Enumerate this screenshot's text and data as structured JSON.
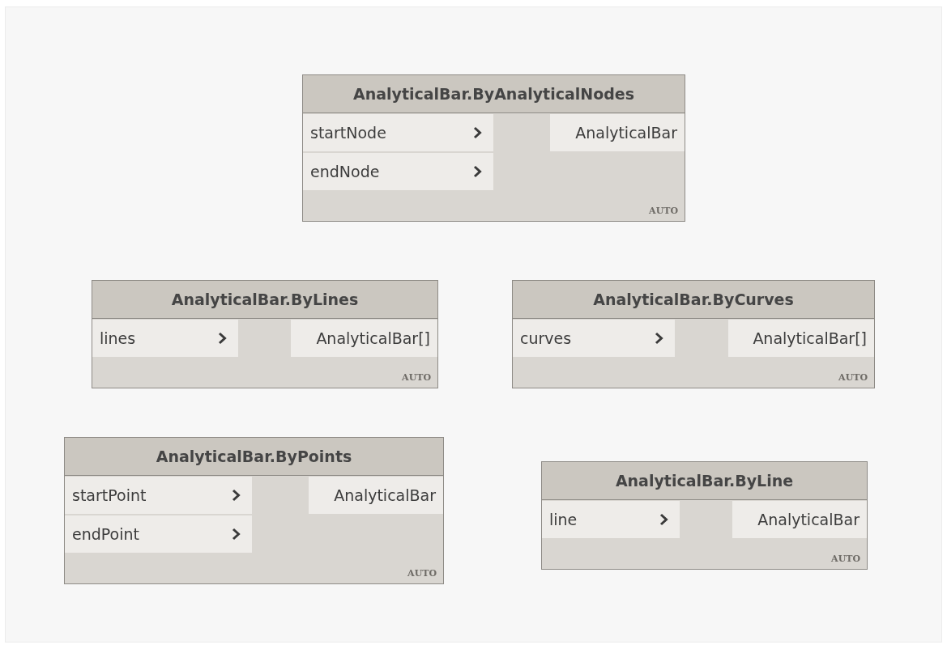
{
  "nodes": [
    {
      "title": "AnalyticalBar.ByAnalyticalNodes",
      "inputs": [
        "startNode",
        "endNode"
      ],
      "outputs": [
        "AnalyticalBar"
      ],
      "lacing": "AUTO"
    },
    {
      "title": "AnalyticalBar.ByLines",
      "inputs": [
        "lines"
      ],
      "outputs": [
        "AnalyticalBar[]"
      ],
      "lacing": "AUTO"
    },
    {
      "title": "AnalyticalBar.ByCurves",
      "inputs": [
        "curves"
      ],
      "outputs": [
        "AnalyticalBar[]"
      ],
      "lacing": "AUTO"
    },
    {
      "title": "AnalyticalBar.ByPoints",
      "inputs": [
        "startPoint",
        "endPoint"
      ],
      "outputs": [
        "AnalyticalBar"
      ],
      "lacing": "AUTO"
    },
    {
      "title": "AnalyticalBar.ByLine",
      "inputs": [
        "line"
      ],
      "outputs": [
        "AnalyticalBar"
      ],
      "lacing": "AUTO"
    }
  ]
}
